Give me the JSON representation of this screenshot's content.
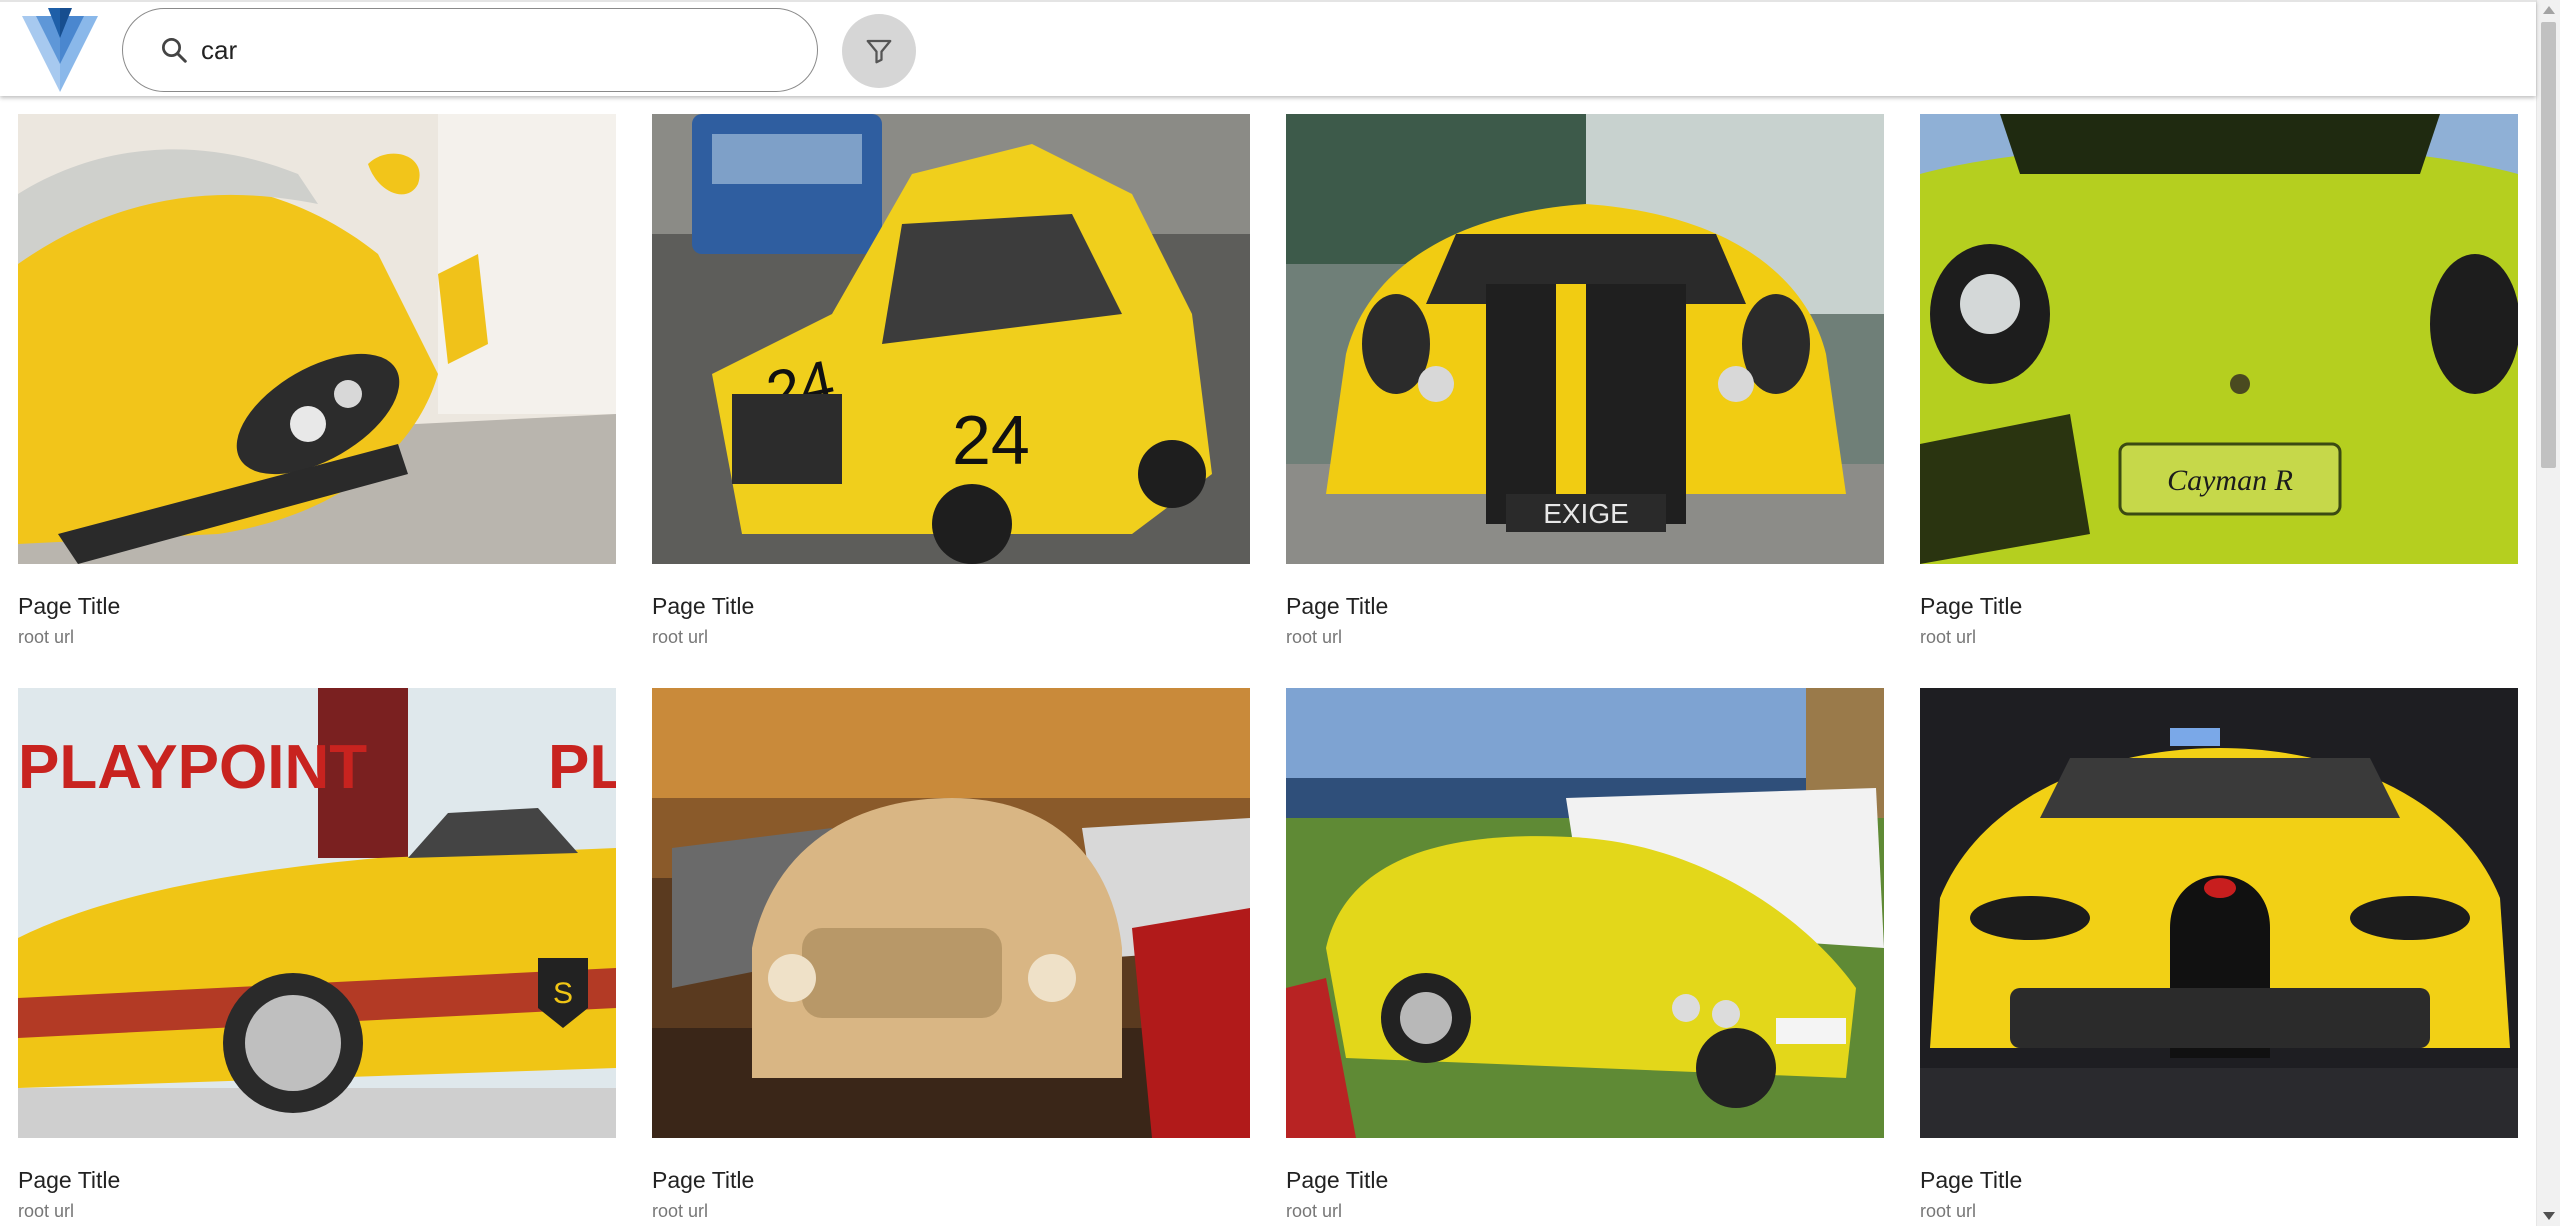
{
  "app": {
    "logo_name": "v-logo",
    "logo_colors": [
      "#1e5fa8",
      "#5e97d8",
      "#a7c9ef"
    ]
  },
  "search": {
    "value": "car",
    "placeholder": "",
    "icon": "search-icon"
  },
  "filter": {
    "icon": "filter-icon",
    "background": "#d6d6d6"
  },
  "results": [
    {
      "title": "Page Title",
      "url": "root url",
      "image": "yellow sports car front close-up",
      "palette": [
        "#e9e3d8",
        "#f2c51a",
        "#3a3a3a"
      ]
    },
    {
      "title": "Page Title",
      "url": "root url",
      "image": "damaged yellow mini race car number 24",
      "palette": [
        "#6b6b66",
        "#f0cf1c",
        "#2c2c2c"
      ]
    },
    {
      "title": "Page Title",
      "url": "root url",
      "image": "yellow lotus exige with black stripes",
      "palette": [
        "#7d8f86",
        "#f1cc12",
        "#222222"
      ]
    },
    {
      "title": "Page Title",
      "url": "root url",
      "image": "lime green porsche cayman r",
      "palette": [
        "#9db8d8",
        "#b9d21f",
        "#3b4a12"
      ]
    },
    {
      "title": "Page Title",
      "url": "root url",
      "image": "yellow ferrari convertible playpoint",
      "palette": [
        "#dfe8ec",
        "#f0c515",
        "#b33a25"
      ]
    },
    {
      "title": "Page Title",
      "url": "root url",
      "image": "gold pt cruiser in parking garage",
      "palette": [
        "#b0712a",
        "#d9b684",
        "#3a2618"
      ]
    },
    {
      "title": "Page Title",
      "url": "root url",
      "image": "yellow classic convertible on grass",
      "palette": [
        "#7ea3d2",
        "#e3d71a",
        "#5f8a35"
      ]
    },
    {
      "title": "Page Title",
      "url": "root url",
      "image": "yellow bugatti veyron front",
      "palette": [
        "#1e1e22",
        "#f2d015",
        "#111111"
      ]
    }
  ]
}
